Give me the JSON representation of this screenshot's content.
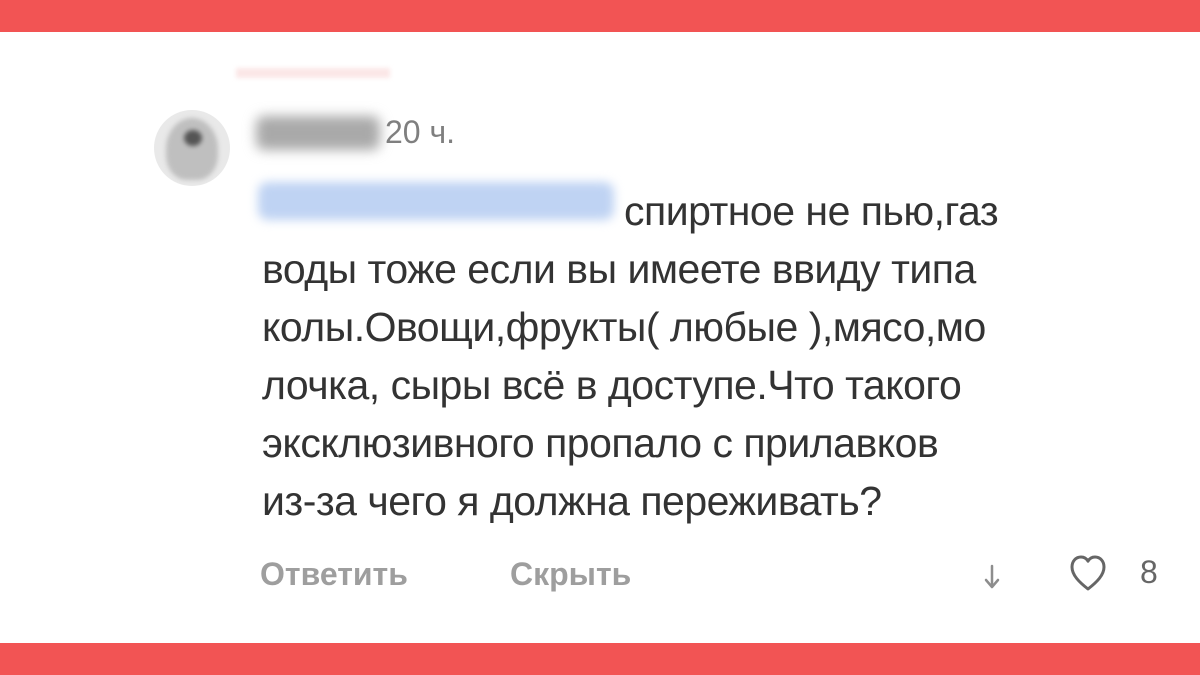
{
  "comment": {
    "time": "20 ч.",
    "text_lines": [
      "спиртное не пью,газ",
      "воды тоже если вы имеете ввиду типа",
      "колы.Овощи,фрукты( любые ),мясо,мо",
      "лочка, сыры всё в доступе.Что такого",
      "эксклюзивного пропало с прилавков",
      "из-за чего я должна переживать?"
    ],
    "actions": {
      "reply_label": "Ответить",
      "hide_label": "Скрыть"
    },
    "likes": "8"
  },
  "icons": {
    "avatar": "avatar",
    "down": "down-arrow-icon",
    "like": "heart-icon"
  },
  "colors": {
    "frame": "#f25454",
    "text": "#333333",
    "muted": "#9e9e9e"
  }
}
